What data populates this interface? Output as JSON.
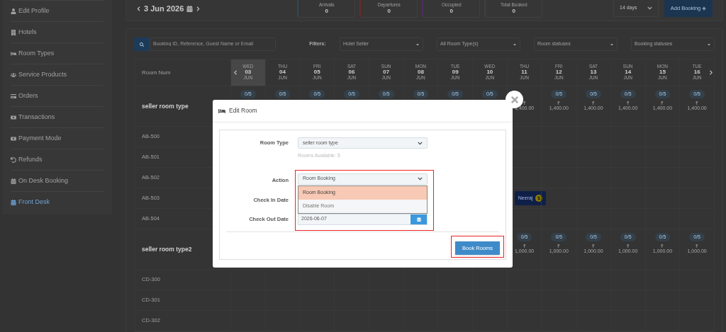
{
  "sidebar": {
    "items": [
      {
        "label": "Edit Profile",
        "selected": false
      },
      {
        "label": "Hotels",
        "selected": false
      },
      {
        "label": "Room Types",
        "selected": false
      },
      {
        "label": "Service Products",
        "selected": false
      },
      {
        "label": "Orders",
        "selected": false
      },
      {
        "label": "Transactions",
        "selected": false
      },
      {
        "label": "Payment Mode",
        "selected": false
      },
      {
        "label": "Refunds",
        "selected": false
      },
      {
        "label": "On Desk Booking",
        "selected": false
      },
      {
        "label": "Front Desk",
        "selected": true
      }
    ]
  },
  "header": {
    "date": "3 Jun 2026",
    "stats": [
      {
        "label": "Arrivals",
        "value": "0",
        "color": "#2e4a5e"
      },
      {
        "label": "Departures",
        "value": "0",
        "color": "#6a2a2a"
      },
      {
        "label": "Occupied",
        "value": "0",
        "color": "#4e2e5a"
      },
      {
        "label": "Total Booked",
        "value": "0",
        "color": "#404040"
      }
    ],
    "period": "14 days",
    "add_button": "Add Booking"
  },
  "filters": {
    "search_placeholder": "Booking ID, Reference, Guest Name or Email",
    "label": "Filters:",
    "selects": [
      "Hotel Seller",
      "All Room Type(s)",
      "Room statuses",
      "Booking statuses"
    ]
  },
  "grid": {
    "first_column": "Room Num",
    "days": [
      {
        "weekday": "WED",
        "day": "03",
        "month": "JUN",
        "selected": true
      },
      {
        "weekday": "THU",
        "day": "04",
        "month": "JUN",
        "selected": false
      },
      {
        "weekday": "FRI",
        "day": "05",
        "month": "JUN",
        "selected": false
      },
      {
        "weekday": "SAT",
        "day": "06",
        "month": "JUN",
        "selected": false
      },
      {
        "weekday": "SUN",
        "day": "07",
        "month": "JUN",
        "selected": false
      },
      {
        "weekday": "MON",
        "day": "08",
        "month": "JUN",
        "selected": false
      },
      {
        "weekday": "TUE",
        "day": "09",
        "month": "JUN",
        "selected": false
      },
      {
        "weekday": "WED",
        "day": "10",
        "month": "JUN",
        "selected": false
      },
      {
        "weekday": "THU",
        "day": "11",
        "month": "JUN",
        "selected": false
      },
      {
        "weekday": "FRI",
        "day": "12",
        "month": "JUN",
        "selected": false
      },
      {
        "weekday": "SAT",
        "day": "13",
        "month": "JUN",
        "selected": false
      },
      {
        "weekday": "SUN",
        "day": "14",
        "month": "JUN",
        "selected": false
      },
      {
        "weekday": "MON",
        "day": "15",
        "month": "JUN",
        "selected": false
      },
      {
        "weekday": "TUE",
        "day": "16",
        "month": "JUN",
        "selected": false
      }
    ],
    "groups": [
      {
        "name": "seller room type",
        "cells": [
          {
            "badge": "0/5"
          },
          {
            "badge": "0/5"
          },
          {
            "badge": "0/5"
          },
          {
            "badge": "0/5"
          },
          {
            "badge": "0/5"
          },
          {
            "badge": "0/5"
          },
          {
            "badge": "0/5"
          },
          {
            "badge": "0/5"
          },
          {
            "currency": "₹",
            "price": "1,400.00"
          },
          {
            "badge": "0/5",
            "currency": "₹",
            "price": "1,400.00"
          },
          {
            "badge": "0/5",
            "currency": "₹",
            "price": "1,400.00"
          },
          {
            "badge": "0/5",
            "currency": "₹",
            "price": "1,400.00"
          },
          {
            "badge": "0/5",
            "currency": "₹",
            "price": "1,400.00"
          },
          {
            "badge": "0/5",
            "currency": "₹",
            "price": "1,400.00"
          }
        ],
        "rooms": [
          {
            "number": "AB-500"
          },
          {
            "number": "AB-501"
          },
          {
            "number": "AB-502"
          },
          {
            "number": "AB-503",
            "cells": [
              null,
              null,
              null,
              null,
              null,
              null,
              null,
              null,
              {
                "guest": "Neeraj"
              },
              null,
              null,
              null,
              null,
              null
            ]
          },
          {
            "number": "AB-504"
          }
        ]
      },
      {
        "name": "seller room type2",
        "cells": [
          null,
          null,
          null,
          null,
          null,
          null,
          null,
          null,
          {
            "badge": "0/5",
            "currency": "₹",
            "price": "1,000.00"
          },
          {
            "badge": "0/5",
            "currency": "₹",
            "price": "1,000.00"
          },
          {
            "badge": "0/5",
            "currency": "₹",
            "price": "1,000.00"
          },
          {
            "badge": "0/5",
            "currency": "₹",
            "price": "1,000.00"
          },
          {
            "badge": "0/5",
            "currency": "₹",
            "price": "1,000.00"
          },
          {
            "badge": "0/5",
            "currency": "₹",
            "price": "1,000.00"
          }
        ],
        "rooms": [
          {
            "number": "CD-300"
          },
          {
            "number": "CD-301"
          },
          {
            "number": "CD-302"
          }
        ]
      }
    ]
  },
  "modal": {
    "title": "Edit Room",
    "room_type": {
      "label": "Room Type",
      "value": "seller room type",
      "note": "Rooms Available: 5"
    },
    "action": {
      "label": "Action",
      "value": "Room Booking",
      "highlighted": true,
      "options": [
        {
          "label": "Room Booking",
          "selected": true
        },
        {
          "label": "Disable Room",
          "selected": false
        }
      ]
    },
    "check_in": {
      "label": "Check In Date"
    },
    "check_out": {
      "label": "Check Out Date",
      "value": "2026-06-07"
    },
    "submit": {
      "label": "Book Rooms",
      "highlighted": true
    }
  }
}
